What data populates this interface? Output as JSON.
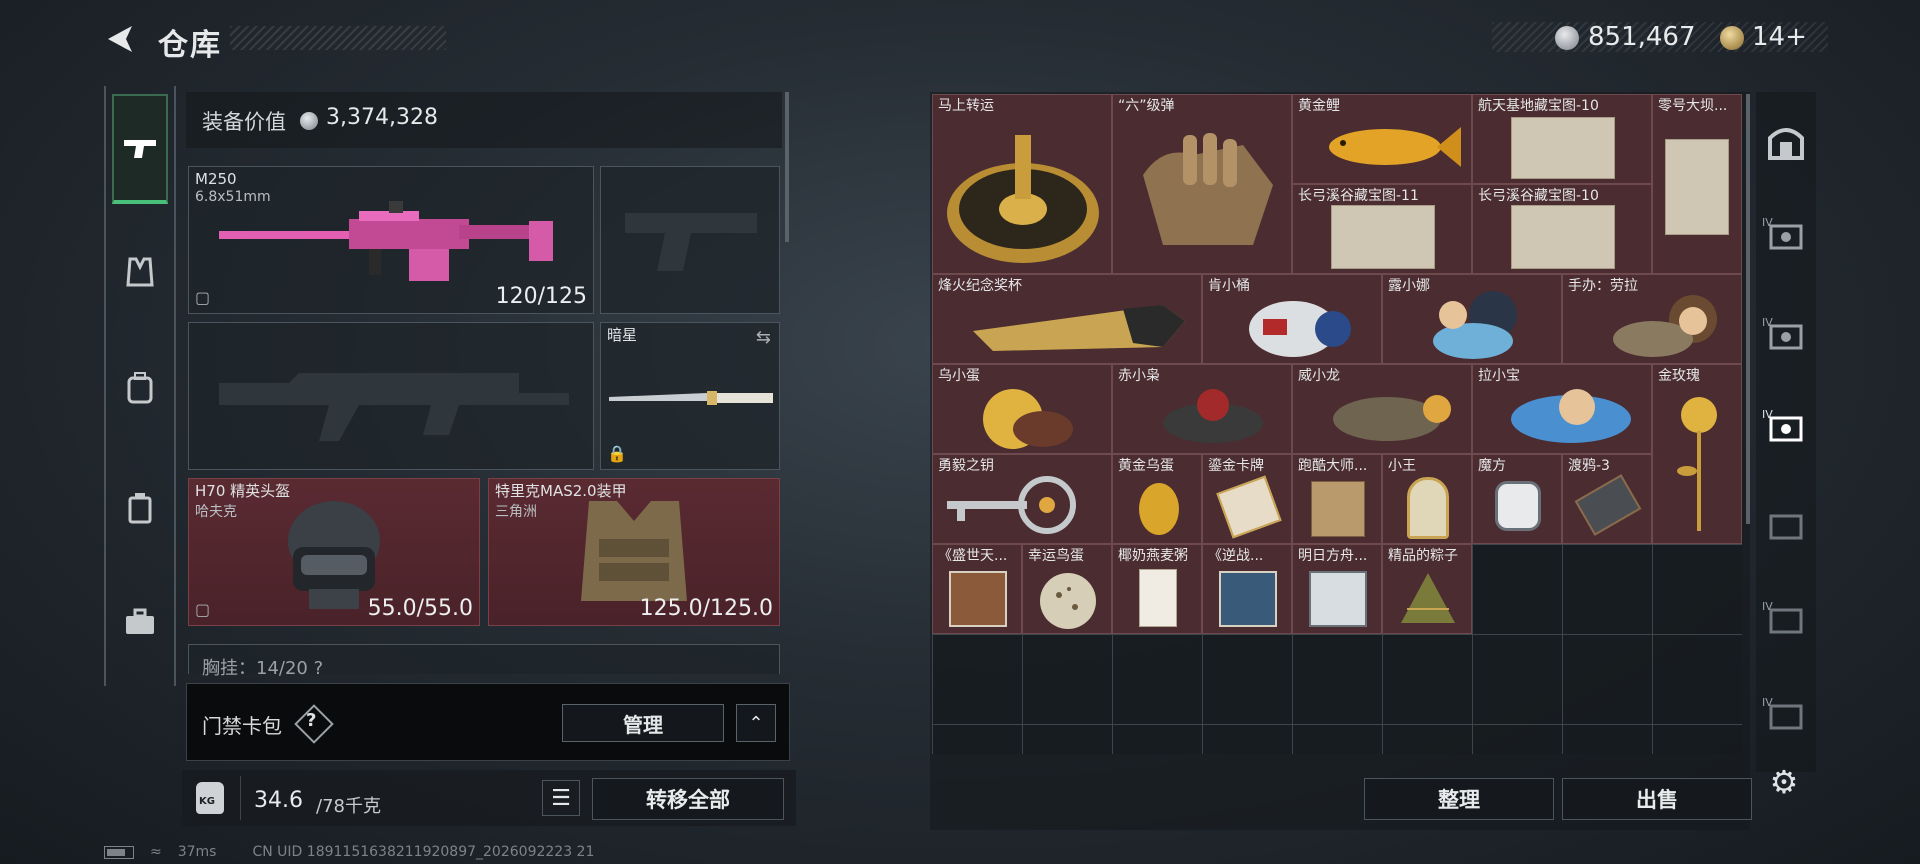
{
  "header": {
    "title": "仓库",
    "silver": "851,467",
    "gold": "14+"
  },
  "equipment": {
    "value_label": "装备价值",
    "value": "3,374,328",
    "primary": {
      "name": "M250",
      "caliber": "6.8x51mm",
      "durability": "120/125"
    },
    "melee": {
      "name": "暗星"
    },
    "helmet": {
      "name": "H70 精英头盔",
      "sub": "哈夫克",
      "durability": "55.0/55.0"
    },
    "armor": {
      "name": "特里克MAS2.0装甲",
      "sub": "三角洲",
      "durability": "125.0/125.0"
    },
    "chest_label": "胸挂：14/20  ?"
  },
  "card_bag": {
    "label": "门禁卡包",
    "help": "?",
    "manage": "管理"
  },
  "weight": {
    "icon": "KG",
    "current": "34.6",
    "max": "/78千克",
    "transfer_all": "转移全部"
  },
  "status": {
    "latency": "37ms",
    "uid": "CN UID 1891151638211920897_2026092223 21"
  },
  "stash": {
    "items": [
      {
        "name": "马上转运"
      },
      {
        "name": "“六”级弹"
      },
      {
        "name": "黄金鲤"
      },
      {
        "name": "航天基地藏宝图-10"
      },
      {
        "name": "零号大坝..."
      },
      {
        "name": "长弓溪谷藏宝图-11"
      },
      {
        "name": "长弓溪谷藏宝图-10"
      },
      {
        "name": "烽火纪念奖杯"
      },
      {
        "name": "肯小桶"
      },
      {
        "name": "露小娜"
      },
      {
        "name": "手办：劳拉"
      },
      {
        "name": "乌小蛋"
      },
      {
        "name": "赤小枭"
      },
      {
        "name": "威小龙"
      },
      {
        "name": "拉小宝"
      },
      {
        "name": "金玫瑰"
      },
      {
        "name": "勇毅之钥"
      },
      {
        "name": "黄金乌蛋"
      },
      {
        "name": "鎏金卡牌"
      },
      {
        "name": "跑酷大师..."
      },
      {
        "name": "小王"
      },
      {
        "name": "魔方"
      },
      {
        "name": "渡鸦-3"
      },
      {
        "name": "《盛世天..."
      },
      {
        "name": "幸运鸟蛋"
      },
      {
        "name": "椰奶燕麦粥"
      },
      {
        "name": "《逆战..."
      },
      {
        "name": "明日方舟..."
      },
      {
        "name": "精品的粽子"
      }
    ],
    "sort": "整理",
    "sell": "出售"
  },
  "right_nav": {
    "level_tag": "IV"
  },
  "colors": {
    "accent_green": "#49c079",
    "item_red": "#4b2c30"
  }
}
